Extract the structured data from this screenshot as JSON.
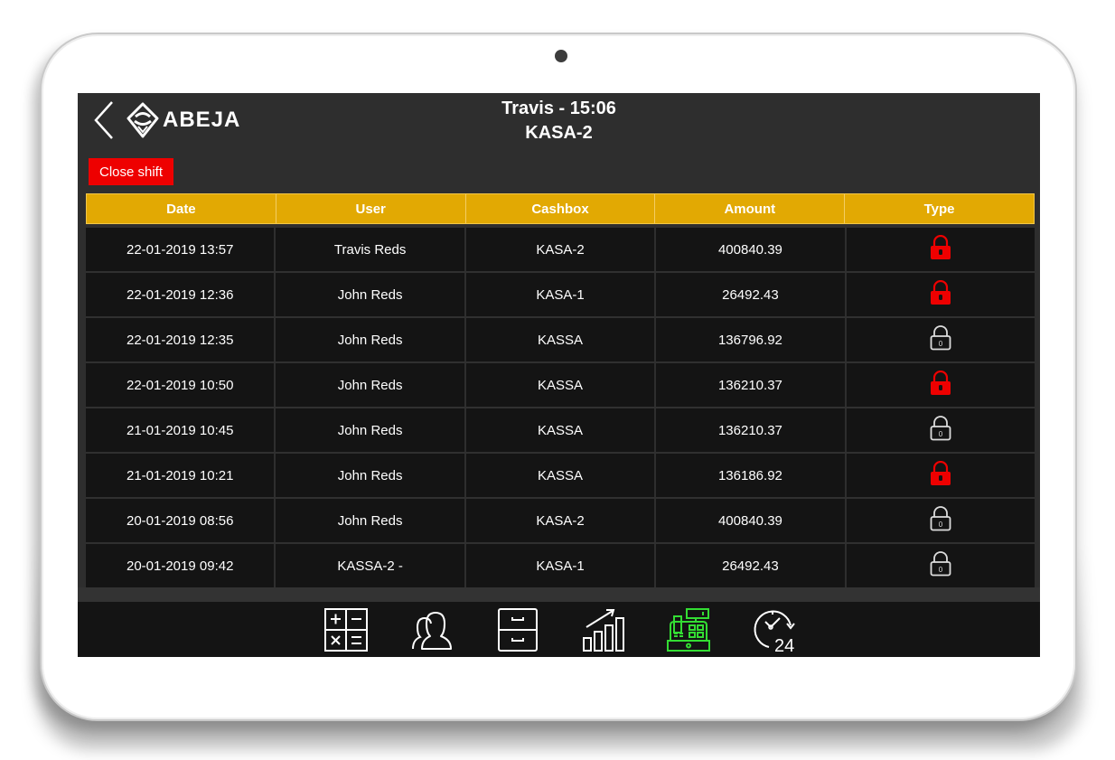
{
  "header": {
    "logo_text": "ABEJA",
    "title_line1": "Travis - 15:06",
    "title_line2": "KASA-2",
    "close_shift_label": "Close shift"
  },
  "table": {
    "columns": [
      "Date",
      "User",
      "Cashbox",
      "Amount",
      "Type"
    ],
    "rows": [
      {
        "date": "22-01-2019 13:57",
        "user": "Travis Reds",
        "cashbox": "KASA-2",
        "amount": "400840.39",
        "type": "closed",
        "type_icon": "lock-icon-red"
      },
      {
        "date": "22-01-2019 12:36",
        "user": "John Reds",
        "cashbox": "KASA-1",
        "amount": "26492.43",
        "type": "closed",
        "type_icon": "lock-icon-red"
      },
      {
        "date": "22-01-2019 12:35",
        "user": "John Reds",
        "cashbox": "KASSA",
        "amount": "136796.92",
        "type": "open",
        "type_icon": "lock-icon-outline"
      },
      {
        "date": "22-01-2019 10:50",
        "user": "John Reds",
        "cashbox": "KASSA",
        "amount": "136210.37",
        "type": "closed",
        "type_icon": "lock-icon-red"
      },
      {
        "date": "21-01-2019 10:45",
        "user": "John Reds",
        "cashbox": "KASSA",
        "amount": "136210.37",
        "type": "open",
        "type_icon": "lock-icon-outline"
      },
      {
        "date": "21-01-2019 10:21",
        "user": "John Reds",
        "cashbox": "KASSA",
        "amount": "136186.92",
        "type": "closed",
        "type_icon": "lock-icon-red"
      },
      {
        "date": "20-01-2019 08:56",
        "user": "John Reds",
        "cashbox": "KASA-2",
        "amount": "400840.39",
        "type": "open",
        "type_icon": "lock-icon-outline"
      },
      {
        "date": "20-01-2019 09:42",
        "user": "KASSA-2 -",
        "cashbox": "KASA-1",
        "amount": "26492.43",
        "type": "open",
        "type_icon": "lock-icon-outline"
      }
    ]
  },
  "nav": {
    "items": [
      {
        "name": "calculator",
        "icon": "calculator-icon",
        "active": false
      },
      {
        "name": "users",
        "icon": "users-icon",
        "active": false
      },
      {
        "name": "cabinet",
        "icon": "cabinet-icon",
        "active": false
      },
      {
        "name": "reports",
        "icon": "chart-growth-icon",
        "active": false
      },
      {
        "name": "cash-register",
        "icon": "cash-register-icon",
        "active": true
      },
      {
        "name": "24h",
        "icon": "clock-24-icon",
        "active": false
      }
    ]
  },
  "colors": {
    "accent_header": "#e2a903",
    "danger": "#ee0000",
    "active_nav": "#33dd33",
    "screen_bg": "#2e2e2e",
    "row_bg": "#141414"
  }
}
